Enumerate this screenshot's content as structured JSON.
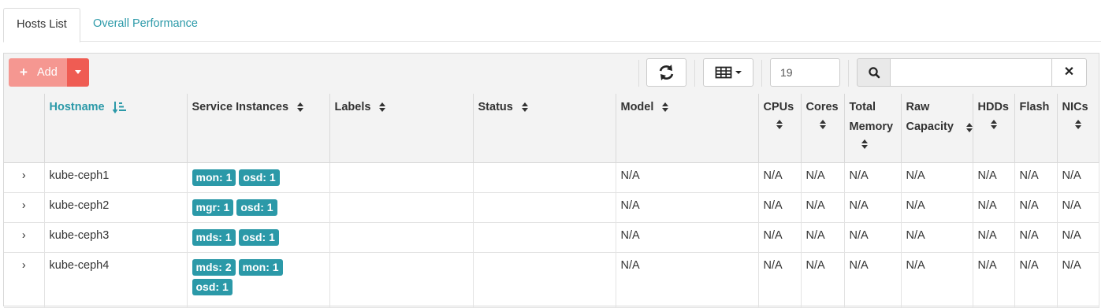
{
  "tabs": [
    {
      "label": "Hosts List",
      "active": true
    },
    {
      "label": "Overall Performance",
      "active": false
    }
  ],
  "toolbar": {
    "add_label": "Add",
    "add_icon": "plus-icon",
    "refresh_icon": "refresh-icon",
    "columns_icon": "table-columns-icon",
    "limit_value": "19",
    "search_placeholder": "",
    "search_icon": "search-icon",
    "clear_icon": "times-icon"
  },
  "columns": [
    {
      "label": "",
      "key": "expand"
    },
    {
      "label": "Hostname",
      "sorted": true,
      "sort_direction": "ascending"
    },
    {
      "label": "Service Instances"
    },
    {
      "label": "Labels"
    },
    {
      "label": "Status"
    },
    {
      "label": "Model"
    },
    {
      "label": "CPUs"
    },
    {
      "label": "Cores"
    },
    {
      "label": "Total Memory"
    },
    {
      "label": "Raw Capacity"
    },
    {
      "label": "HDDs"
    },
    {
      "label": "Flash"
    },
    {
      "label": "NICs"
    }
  ],
  "rows": [
    {
      "hostname": "kube-ceph1",
      "services": [
        "mon: 1",
        "osd: 1"
      ],
      "labels": "",
      "status": "",
      "model": "N/A",
      "cpus": "N/A",
      "cores": "N/A",
      "total_memory": "N/A",
      "raw_capacity": "N/A",
      "hdds": "N/A",
      "flash": "N/A",
      "nics": "N/A"
    },
    {
      "hostname": "kube-ceph2",
      "services": [
        "mgr: 1",
        "osd: 1"
      ],
      "labels": "",
      "status": "",
      "model": "N/A",
      "cpus": "N/A",
      "cores": "N/A",
      "total_memory": "N/A",
      "raw_capacity": "N/A",
      "hdds": "N/A",
      "flash": "N/A",
      "nics": "N/A"
    },
    {
      "hostname": "kube-ceph3",
      "services": [
        "mds: 1",
        "osd: 1"
      ],
      "labels": "",
      "status": "",
      "model": "N/A",
      "cpus": "N/A",
      "cores": "N/A",
      "total_memory": "N/A",
      "raw_capacity": "N/A",
      "hdds": "N/A",
      "flash": "N/A",
      "nics": "N/A"
    },
    {
      "hostname": "kube-ceph4",
      "services": [
        "mds: 2",
        "mon: 1",
        "osd: 1"
      ],
      "labels": "",
      "status": "",
      "model": "N/A",
      "cpus": "N/A",
      "cores": "N/A",
      "total_memory": "N/A",
      "raw_capacity": "N/A",
      "hdds": "N/A",
      "flash": "N/A",
      "nics": "N/A"
    }
  ],
  "colors": {
    "accent": "#2b99a8",
    "add_button": "#f59791",
    "add_caret": "#ef5c53",
    "header_bg": "#f3f3f3"
  }
}
